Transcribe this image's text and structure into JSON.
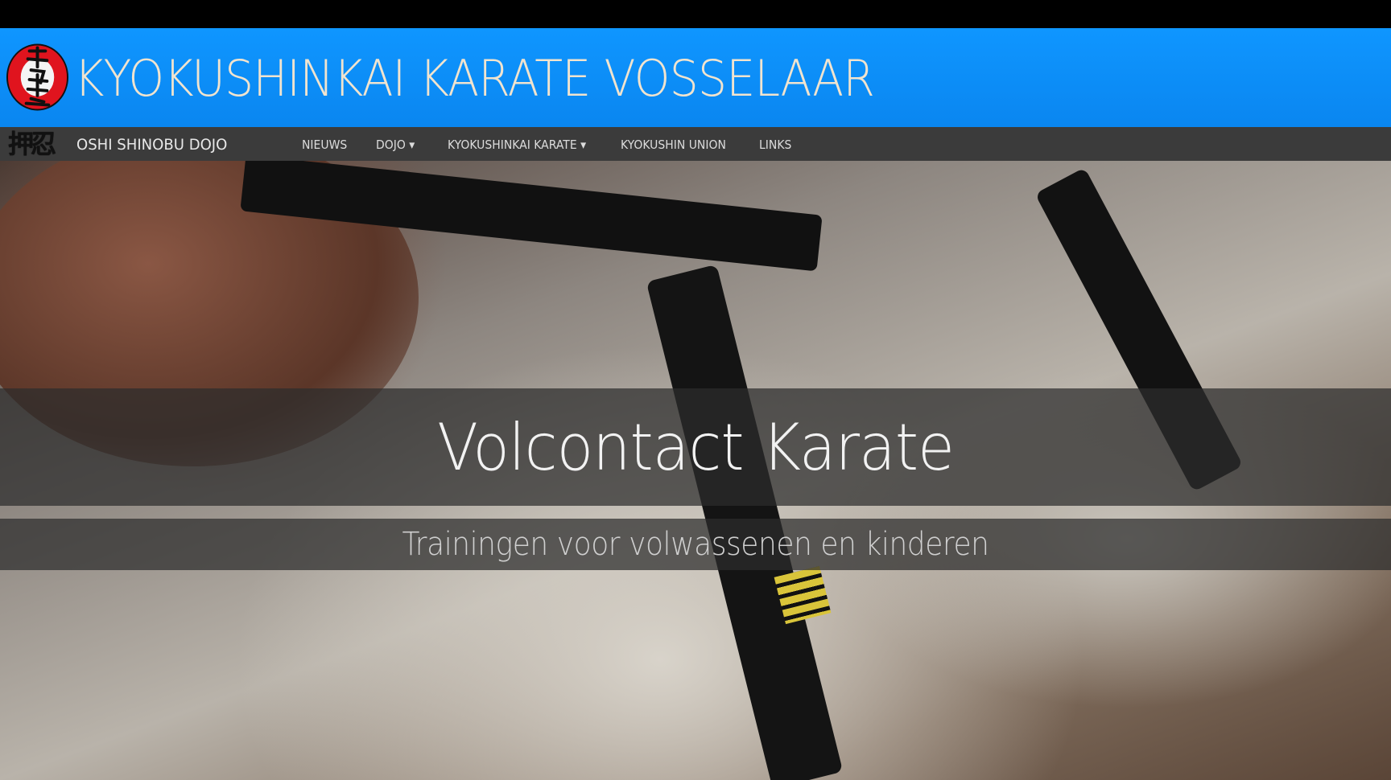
{
  "header": {
    "title": "KYOKUSHINKAI KARATE VOSSELAAR",
    "logo_icon": "kyokushin-kanku-logo-icon",
    "colors": {
      "header_blue": "#0a8cf5",
      "logo_red": "#e0141e",
      "title_text": "#f1e4cf"
    }
  },
  "navbar": {
    "brand_kanji": "押忍",
    "brand_name": "OSHI SHINOBU DOJO",
    "items": [
      {
        "label": "NIEUWS"
      },
      {
        "label": "DOJO ▾"
      },
      {
        "label": "KYOKUSHINKAI KARATE ▾"
      },
      {
        "label": "KYOKUSHIN UNION"
      },
      {
        "label": "LINKS"
      }
    ],
    "colors": {
      "background": "#3b3b3b",
      "text": "#dcdcdc"
    }
  },
  "hero": {
    "title": "Volcontact Karate",
    "subtitle": "Trainingen voor volwassenen en kinderen"
  }
}
